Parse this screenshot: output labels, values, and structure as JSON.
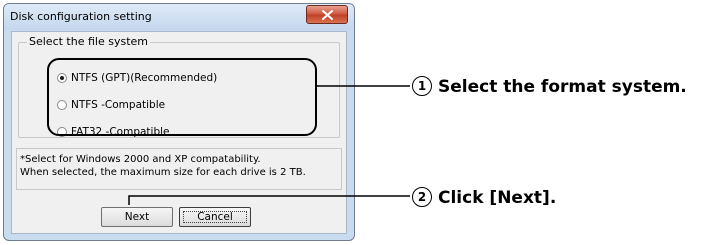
{
  "window": {
    "title": "Disk configuration setting"
  },
  "group": {
    "legend": "Select the file system",
    "options": [
      {
        "label": "NTFS (GPT)(Recommended)",
        "selected": true
      },
      {
        "label": "NTFS -Compatible",
        "selected": false
      },
      {
        "label": "FAT32 -Compatible",
        "selected": false
      }
    ]
  },
  "note": {
    "line1": "*Select for Windows 2000 and XP compatability.",
    "line2": "When selected, the maximum size for each drive is 2 TB."
  },
  "buttons": {
    "next": "Next",
    "cancel": "Cancel"
  },
  "callouts": [
    {
      "number": "1",
      "text": "Select the format system."
    },
    {
      "number": "2",
      "text": "Click [Next]."
    }
  ]
}
